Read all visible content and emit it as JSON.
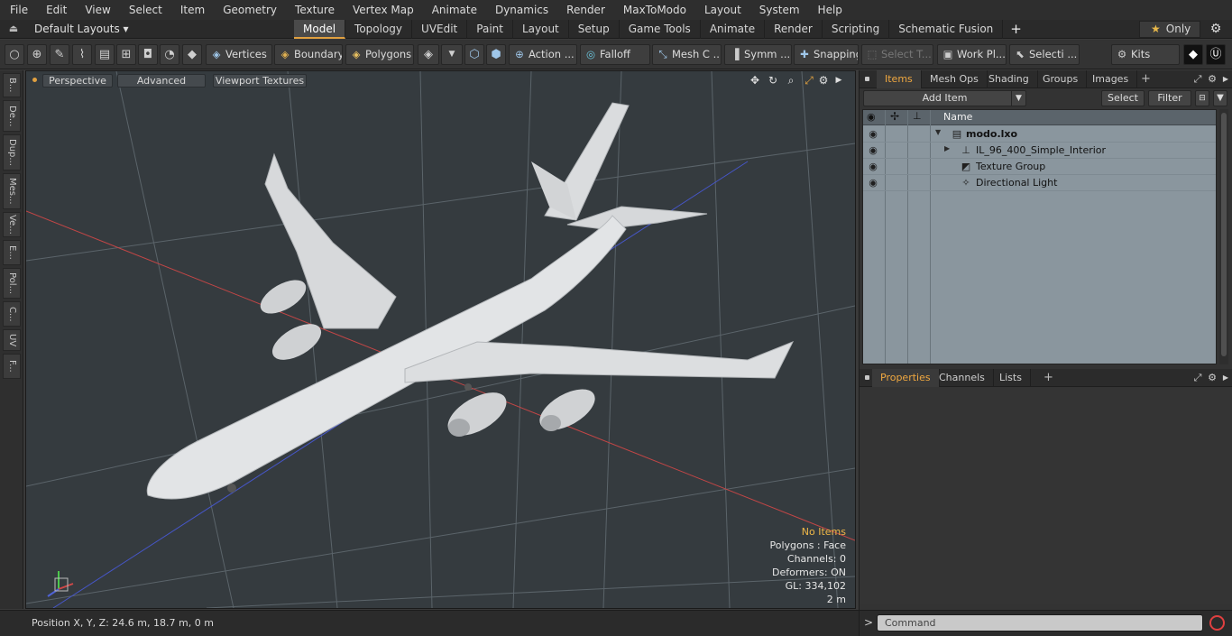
{
  "menu": [
    "File",
    "Edit",
    "View",
    "Select",
    "Item",
    "Geometry",
    "Texture",
    "Vertex Map",
    "Animate",
    "Dynamics",
    "Render",
    "MaxToModo",
    "Layout",
    "System",
    "Help"
  ],
  "layoutbar": {
    "default_layouts": "Default Layouts ▾",
    "tabs": [
      "Model",
      "Topology",
      "UVEdit",
      "Paint",
      "Layout",
      "Setup",
      "Game Tools",
      "Animate",
      "Render",
      "Scripting",
      "Schematic Fusion"
    ],
    "active_tab": "Model",
    "plus": "+",
    "only_label": "Only"
  },
  "toolbar": {
    "vertices": "Vertices",
    "boundary": "Boundary",
    "polygons": "Polygons",
    "action": "Action",
    "action_more": "...",
    "falloff": "Falloff",
    "mesh": "Mesh C ...",
    "symm": "Symm ...",
    "snapping": "Snapping",
    "select_t": "Select T...",
    "work_plane": "Work Pl...",
    "selecti": "Selecti ...",
    "kits": "Kits"
  },
  "left_tabs": [
    "B...",
    "De...",
    "Dup...",
    "Mes...",
    "Ve...",
    "E...",
    "Pol...",
    "C...",
    "UV",
    "F..."
  ],
  "viewport": {
    "perspective": "Perspective",
    "advanced": "Advanced",
    "viewport_textures": "Viewport Textures",
    "info": {
      "no_items": "No Items",
      "polygons": "Polygons : Face",
      "channels": "Channels: 0",
      "deformers": "Deformers: ON",
      "gl": "GL: 334,102",
      "scale": "2 m"
    },
    "colors": {
      "background": "#353b3f",
      "accent": "#e8a640"
    }
  },
  "status": {
    "position": "Position X, Y, Z:   24.6 m, 18.7 m, 0 m"
  },
  "items_panel": {
    "tabs": [
      "Items",
      "Mesh Ops",
      "Shading",
      "Groups",
      "Images"
    ],
    "active_tab": "Items",
    "add_item": "Add Item",
    "select": "Select",
    "filter": "Filter",
    "column_name": "Name",
    "rows": [
      {
        "label": "modo.lxo",
        "icon": "scene-icon"
      },
      {
        "label": "IL_96_400_Simple_Interior",
        "icon": "mesh-locator-icon"
      },
      {
        "label": "Texture Group",
        "icon": "texture-group-icon"
      },
      {
        "label": "Directional Light",
        "icon": "light-icon"
      }
    ]
  },
  "properties_panel": {
    "tabs": [
      "Properties",
      "Channels",
      "Lists"
    ],
    "active_tab": "Properties"
  },
  "command": {
    "prompt": ">",
    "placeholder": "Command"
  }
}
